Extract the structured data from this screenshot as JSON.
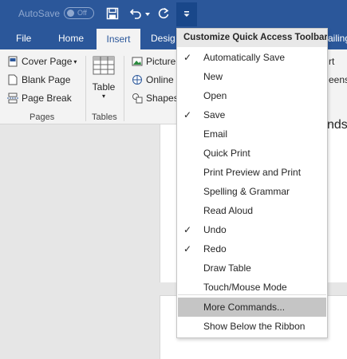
{
  "titlebar": {
    "autosave_label": "AutoSave",
    "autosave_state": "Off",
    "customize_glyph": "▾"
  },
  "tabs": [
    {
      "label": "File"
    },
    {
      "label": "Home"
    },
    {
      "label": "Insert"
    },
    {
      "label": "Desig"
    },
    {
      "label": "ailing"
    }
  ],
  "ribbon": {
    "pages_group": {
      "items": [
        {
          "label": "Cover Page",
          "arrow": "▾"
        },
        {
          "label": "Blank Page"
        },
        {
          "label": "Page Break"
        }
      ],
      "label": "Pages"
    },
    "tables_group": {
      "table_label": "Table",
      "arrow": "▾",
      "label": "Tables"
    },
    "illustrations_group": {
      "items": [
        {
          "label": "Picture"
        },
        {
          "label": "Online"
        },
        {
          "label": "Shapes"
        }
      ]
    },
    "right_partial": {
      "line1": "rt",
      "line2": "eensh"
    }
  },
  "document": {
    "partial_text": "nds"
  },
  "menu": {
    "header": "Customize Quick Access Toolbar",
    "check_glyph": "✓",
    "items": [
      {
        "label": "Automatically Save",
        "checked": true
      },
      {
        "label": "New",
        "checked": false
      },
      {
        "label": "Open",
        "checked": false
      },
      {
        "label": "Save",
        "checked": true
      },
      {
        "label": "Email",
        "checked": false
      },
      {
        "label": "Quick Print",
        "checked": false
      },
      {
        "label": "Print Preview and Print",
        "checked": false
      },
      {
        "label": "Spelling & Grammar",
        "checked": false
      },
      {
        "label": "Read Aloud",
        "checked": false
      },
      {
        "label": "Undo",
        "checked": true
      },
      {
        "label": "Redo",
        "checked": true
      },
      {
        "label": "Draw Table",
        "checked": false
      },
      {
        "label": "Touch/Mouse Mode",
        "checked": false
      }
    ],
    "more_commands": "More Commands...",
    "show_below": "Show Below the Ribbon"
  },
  "colors": {
    "titlebar": "#2b579a",
    "ribbon": "#f3f3f3",
    "menu_highlight": "#c5c5c5",
    "menu_header": "#e8e8e8"
  }
}
